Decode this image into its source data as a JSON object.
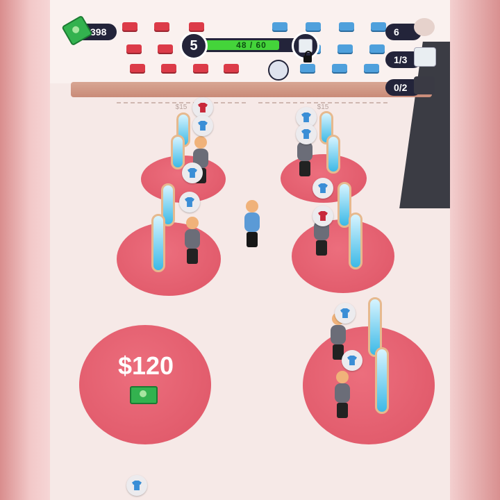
{
  "hud": {
    "money": "398",
    "level": "5",
    "xp_text": "48 / 60",
    "xp_progress": 0.8,
    "stat_1": "6",
    "stat_2": "1/3",
    "stat_3": "0/2"
  },
  "store": {
    "price_tag_left": "$15",
    "price_tag_right": "$15",
    "buy_area_price": "$120"
  },
  "icons": {
    "money": "cash-icon",
    "unlock": "locked-item-icon",
    "worker": "worker-avatar-icon",
    "shirt": "tshirt-icon"
  },
  "colors": {
    "hud_bg": "#23243a",
    "xp_fill": "#44d43a",
    "fitting_mat": "#e25a6b",
    "shirt_blue": "#3a8ed6",
    "shirt_red": "#c8283a"
  }
}
